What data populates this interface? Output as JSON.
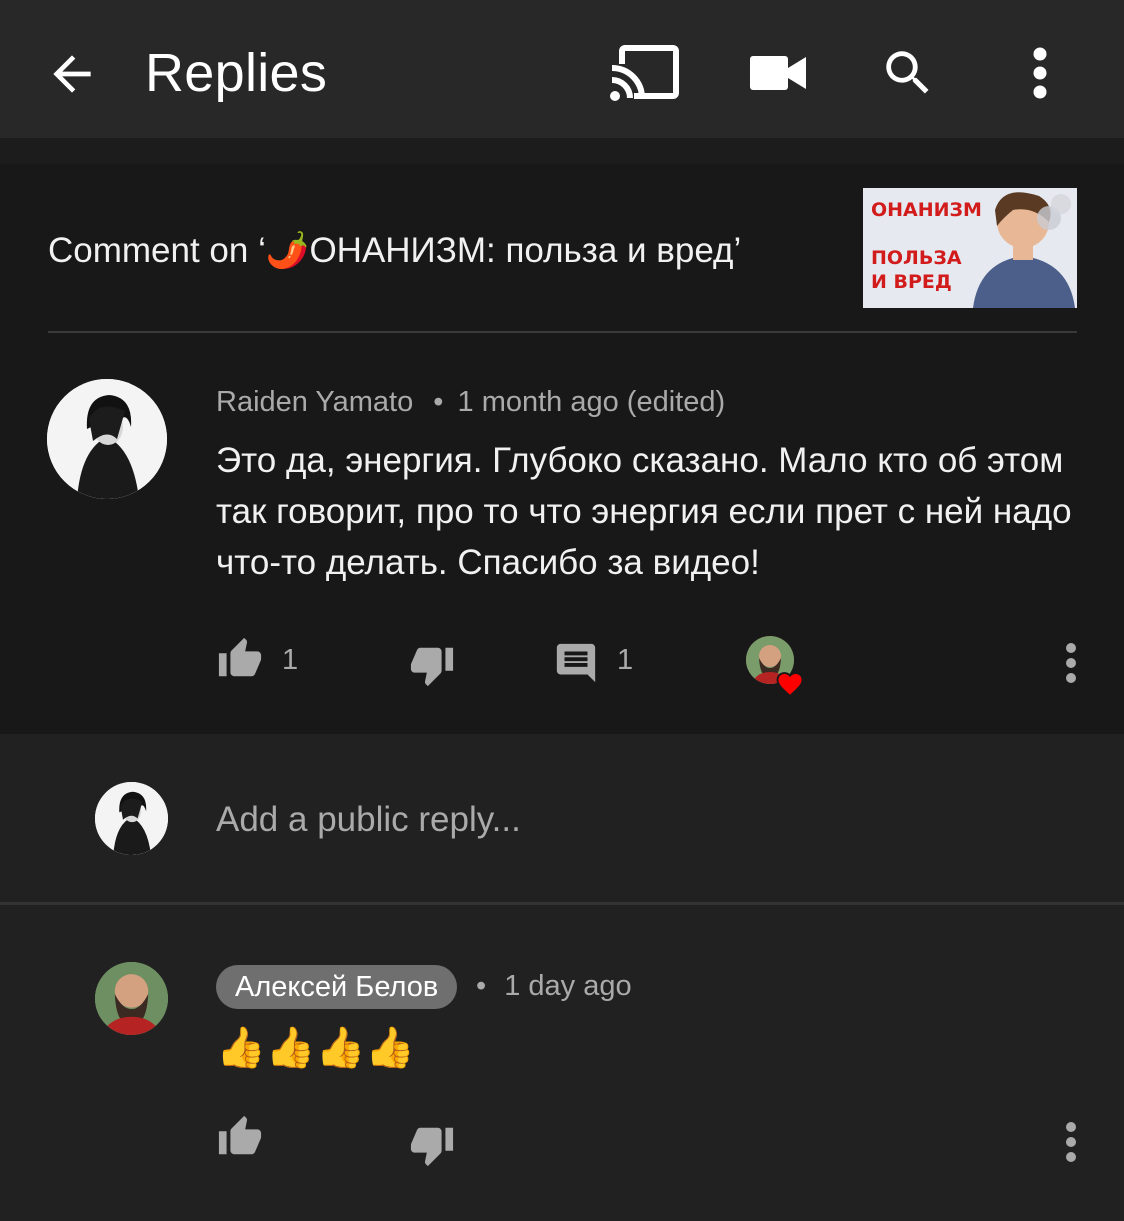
{
  "header": {
    "title": "Replies",
    "icons": [
      "back-arrow-icon",
      "cast-icon",
      "video-camera-icon",
      "search-icon",
      "more-vert-icon"
    ]
  },
  "context": {
    "comment_on": "Comment on ‘🌶️ОНАНИЗМ: польза и вред’",
    "thumbnail_line1": "ОНАНИЗМ",
    "thumbnail_line2": "ПОЛЬЗА",
    "thumbnail_line3": "И ВРЕД"
  },
  "parent_comment": {
    "author": "Raiden Yamato",
    "separator": "•",
    "time": "1 month ago (edited)",
    "text": "Это да, энергия. Глубоко сказано. Мало кто об этом так говорит, про то что энергия если прет с ней надо что-то делать. Спасибо за видео!",
    "likes": "1",
    "replies": "1"
  },
  "reply_box": {
    "placeholder": "Add a public reply..."
  },
  "reply": {
    "author": "Алексей Белов",
    "separator": "•",
    "time": "1 day ago",
    "text": "👍👍👍👍"
  },
  "colors": {
    "appbar": "#282828",
    "background": "#212121",
    "comment_bg": "#181818",
    "text_secondary": "#aaaaaa",
    "heart": "#ff0000",
    "chip": "#6f6f6f"
  }
}
